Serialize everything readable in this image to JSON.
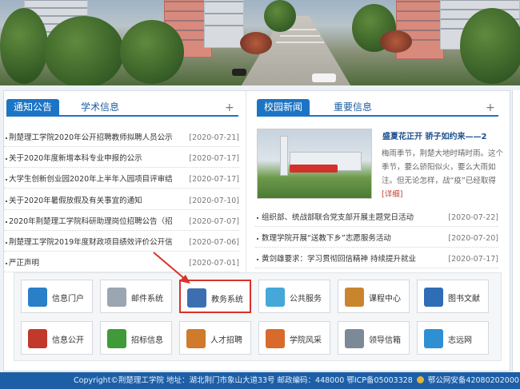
{
  "banner": {
    "alt": ""
  },
  "notice": {
    "tab_active": "通知公告",
    "tab_other": "学术信息",
    "plus": "+",
    "items": [
      {
        "title": "荆楚理工学院2020年公开招聘教师拟聘人员公示",
        "date": "[2020-07-21]"
      },
      {
        "title": "关于2020年度新增本科专业申报的公示",
        "date": "[2020-07-17]"
      },
      {
        "title": "大学生创新创业园2020年上半年入园项目评审结",
        "date": "[2020-07-17]"
      },
      {
        "title": "关于2020年暑假放假及有关事宜的通知",
        "date": "[2020-07-10]"
      },
      {
        "title": "2020年荆楚理工学院科研助理岗位招聘公告（招",
        "date": "[2020-07-07]"
      },
      {
        "title": "荆楚理工学院2019年度财政项目绩效评价公开信",
        "date": "[2020-07-06]"
      },
      {
        "title": "严正声明",
        "date": "[2020-07-01]"
      }
    ]
  },
  "campus": {
    "tab_active": "校园新闻",
    "tab_other": "重要信息",
    "plus": "+",
    "feature_title": "盛夏花正开 骄子如约来——2",
    "feature_text": "梅雨季节，荆楚大地时晴时雨。这个季节，要么骄阳似火，要么大雨如注。但无论怎样，战“疫”已经取得",
    "feature_more": "[详细]",
    "items": [
      {
        "title": "组织部、统战部联合党支部开展主题党日活动",
        "date": "[2020-07-22]"
      },
      {
        "title": "数理学院开展“送教下乡”志愿服务活动",
        "date": "[2020-07-20]"
      },
      {
        "title": "黄剑雄要求：学习贯彻回信精神 持续提升就业",
        "date": "[2020-07-17]"
      }
    ]
  },
  "quick_links": [
    {
      "label": "信息门户",
      "icon": "portal-icon",
      "color": "#2a7fc9"
    },
    {
      "label": "邮件系统",
      "icon": "mail-icon",
      "color": "#9aa6b2"
    },
    {
      "label": "教务系统",
      "icon": "laptop-icon",
      "color": "#3c6fb0",
      "highlight": true
    },
    {
      "label": "公共服务",
      "icon": "chat-bubble-icon",
      "color": "#45a8d8"
    },
    {
      "label": "课程中心",
      "icon": "books-icon",
      "color": "#c9852e"
    },
    {
      "label": "图书文献",
      "icon": "book-icon",
      "color": "#2f6db5"
    },
    {
      "label": "信息公开",
      "icon": "document-icon",
      "color": "#c0392b"
    },
    {
      "label": "招标信息",
      "icon": "handshake-icon",
      "color": "#3f9a3a"
    },
    {
      "label": "人才招聘",
      "icon": "people-icon",
      "color": "#d07a2b"
    },
    {
      "label": "学院风采",
      "icon": "building-icon",
      "color": "#d86a2c"
    },
    {
      "label": "领导信箱",
      "icon": "envelope-icon",
      "color": "#7c8a97"
    },
    {
      "label": "志远网",
      "icon": "compass-icon",
      "color": "#2f8fd3"
    }
  ],
  "footer": {
    "text": "Copyright©荆楚理工学院 地址：湖北荆门市象山大道33号 邮政编码：448000 鄂ICP备05003328",
    "text2": "鄂公网安备42080202000"
  },
  "colors": {
    "accent": "#1c74c4",
    "highlight": "#d8322a",
    "footer": "#1d5fa6"
  }
}
